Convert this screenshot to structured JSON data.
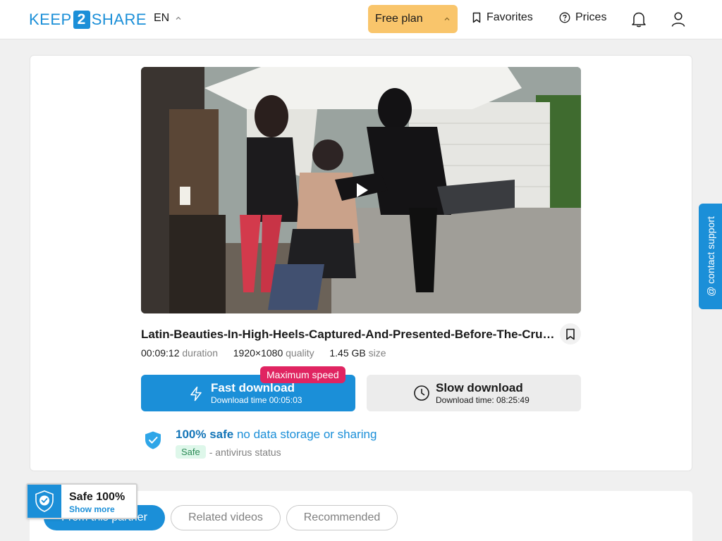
{
  "header": {
    "logo_left": "KEEP",
    "logo_mid": "2",
    "logo_right": "SHARE",
    "language": "EN",
    "plan_label": "Free plan",
    "favorites_label": "Favorites",
    "prices_label": "Prices"
  },
  "video": {
    "title": "Latin-Beauties-In-High-Heels-Captured-And-Presented-Before-The-Cruel-Qu...",
    "duration_value": "00:09:12",
    "duration_label": "duration",
    "quality_value": "1920×1080",
    "quality_label": "quality",
    "size_value": "1.45 GB",
    "size_label": "size"
  },
  "download": {
    "fast_label": "Fast download",
    "fast_time": "Download time 00:05:03",
    "badge": "Maximum speed",
    "slow_label": "Slow download",
    "slow_time": "Download time: 08:25:49"
  },
  "safety": {
    "headline_strong": "100% safe",
    "headline_rest": "no data storage or sharing",
    "status_pill": "Safe",
    "status_text": "- antivirus status"
  },
  "contact_support": "@ contact support",
  "tabs": [
    "From this partner",
    "Related videos",
    "Recommended"
  ],
  "safe_widget": {
    "title": "Safe 100%",
    "link": "Show more"
  },
  "colors": {
    "brand_blue": "#1b8fd8",
    "plan_yellow": "#f9c56b",
    "badge_red": "#e02461"
  }
}
